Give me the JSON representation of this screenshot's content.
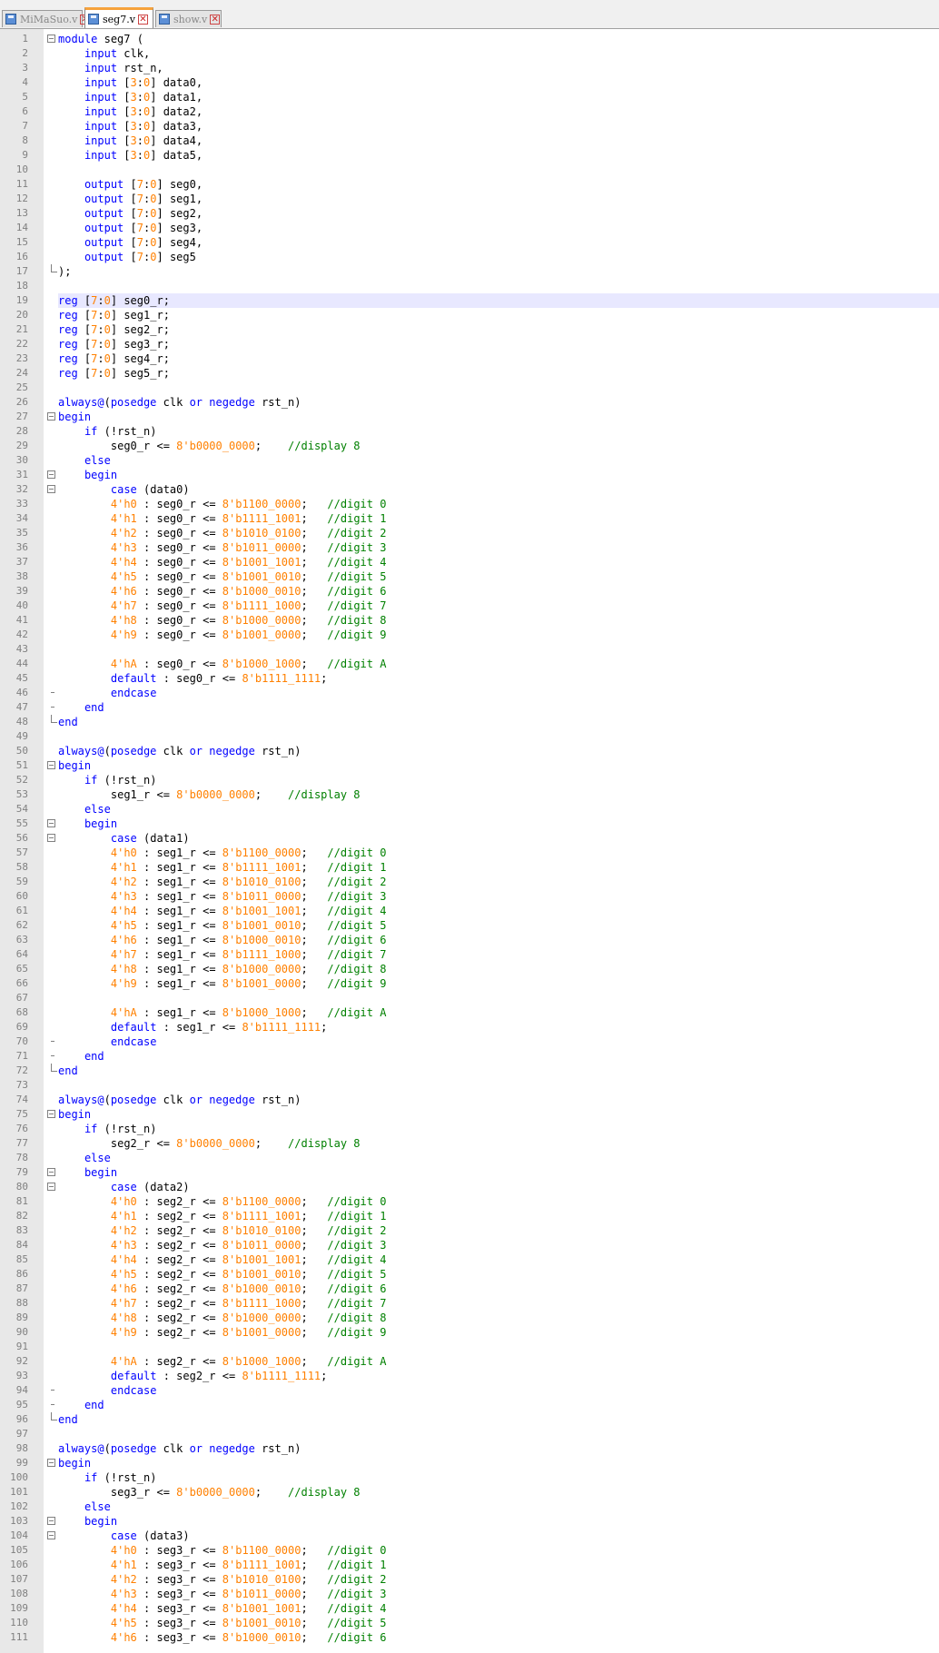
{
  "tabs": [
    {
      "label": "MiMaSuo.v",
      "active": false
    },
    {
      "label": "seg7.v",
      "active": true
    },
    {
      "label": "show.v",
      "active": false
    }
  ],
  "editor": {
    "highlight_line": 19,
    "lines": [
      "module seg7 (",
      "    input clk,",
      "    input rst_n,",
      "    input [3:0] data0,",
      "    input [3:0] data1,",
      "    input [3:0] data2,",
      "    input [3:0] data3,",
      "    input [3:0] data4,",
      "    input [3:0] data5,",
      "",
      "    output [7:0] seg0,",
      "    output [7:0] seg1,",
      "    output [7:0] seg2,",
      "    output [7:0] seg3,",
      "    output [7:0] seg4,",
      "    output [7:0] seg5",
      ");",
      "",
      "reg [7:0] seg0_r;",
      "reg [7:0] seg1_r;",
      "reg [7:0] seg2_r;",
      "reg [7:0] seg3_r;",
      "reg [7:0] seg4_r;",
      "reg [7:0] seg5_r;",
      "",
      "always@(posedge clk or negedge rst_n)",
      "begin",
      "    if (!rst_n)",
      "        seg0_r <= 8'b0000_0000;    //display 8",
      "    else",
      "    begin",
      "        case (data0)",
      "        4'h0 : seg0_r <= 8'b1100_0000;   //digit 0",
      "        4'h1 : seg0_r <= 8'b1111_1001;   //digit 1",
      "        4'h2 : seg0_r <= 8'b1010_0100;   //digit 2",
      "        4'h3 : seg0_r <= 8'b1011_0000;   //digit 3",
      "        4'h4 : seg0_r <= 8'b1001_1001;   //digit 4",
      "        4'h5 : seg0_r <= 8'b1001_0010;   //digit 5",
      "        4'h6 : seg0_r <= 8'b1000_0010;   //digit 6",
      "        4'h7 : seg0_r <= 8'b1111_1000;   //digit 7",
      "        4'h8 : seg0_r <= 8'b1000_0000;   //digit 8",
      "        4'h9 : seg0_r <= 8'b1001_0000;   //digit 9",
      "",
      "        4'hA : seg0_r <= 8'b1000_1000;   //digit A",
      "        default : seg0_r <= 8'b1111_1111;",
      "        endcase",
      "    end",
      "end",
      "",
      "always@(posedge clk or negedge rst_n)",
      "begin",
      "    if (!rst_n)",
      "        seg1_r <= 8'b0000_0000;    //display 8",
      "    else",
      "    begin",
      "        case (data1)",
      "        4'h0 : seg1_r <= 8'b1100_0000;   //digit 0",
      "        4'h1 : seg1_r <= 8'b1111_1001;   //digit 1",
      "        4'h2 : seg1_r <= 8'b1010_0100;   //digit 2",
      "        4'h3 : seg1_r <= 8'b1011_0000;   //digit 3",
      "        4'h4 : seg1_r <= 8'b1001_1001;   //digit 4",
      "        4'h5 : seg1_r <= 8'b1001_0010;   //digit 5",
      "        4'h6 : seg1_r <= 8'b1000_0010;   //digit 6",
      "        4'h7 : seg1_r <= 8'b1111_1000;   //digit 7",
      "        4'h8 : seg1_r <= 8'b1000_0000;   //digit 8",
      "        4'h9 : seg1_r <= 8'b1001_0000;   //digit 9",
      "",
      "        4'hA : seg1_r <= 8'b1000_1000;   //digit A",
      "        default : seg1_r <= 8'b1111_1111;",
      "        endcase",
      "    end",
      "end",
      "",
      "always@(posedge clk or negedge rst_n)",
      "begin",
      "    if (!rst_n)",
      "        seg2_r <= 8'b0000_0000;    //display 8",
      "    else",
      "    begin",
      "        case (data2)",
      "        4'h0 : seg2_r <= 8'b1100_0000;   //digit 0",
      "        4'h1 : seg2_r <= 8'b1111_1001;   //digit 1",
      "        4'h2 : seg2_r <= 8'b1010_0100;   //digit 2",
      "        4'h3 : seg2_r <= 8'b1011_0000;   //digit 3",
      "        4'h4 : seg2_r <= 8'b1001_1001;   //digit 4",
      "        4'h5 : seg2_r <= 8'b1001_0010;   //digit 5",
      "        4'h6 : seg2_r <= 8'b1000_0010;   //digit 6",
      "        4'h7 : seg2_r <= 8'b1111_1000;   //digit 7",
      "        4'h8 : seg2_r <= 8'b1000_0000;   //digit 8",
      "        4'h9 : seg2_r <= 8'b1001_0000;   //digit 9",
      "",
      "        4'hA : seg2_r <= 8'b1000_1000;   //digit A",
      "        default : seg2_r <= 8'b1111_1111;",
      "        endcase",
      "    end",
      "end",
      "",
      "always@(posedge clk or negedge rst_n)",
      "begin",
      "    if (!rst_n)",
      "        seg3_r <= 8'b0000_0000;    //display 8",
      "    else",
      "    begin",
      "        case (data3)",
      "        4'h0 : seg3_r <= 8'b1100_0000;   //digit 0",
      "        4'h1 : seg3_r <= 8'b1111_1001;   //digit 1",
      "        4'h2 : seg3_r <= 8'b1010_0100;   //digit 2",
      "        4'h3 : seg3_r <= 8'b1011_0000;   //digit 3",
      "        4'h4 : seg3_r <= 8'b1001_1001;   //digit 4",
      "        4'h5 : seg3_r <= 8'b1001_0010;   //digit 5",
      "        4'h6 : seg3_r <= 8'b1000_0010;   //digit 6"
    ]
  },
  "colors": {
    "keyword": "#0000ff",
    "number": "#ff8000",
    "comment": "#008000",
    "active_tab_accent": "#f6a23c",
    "current_line": "#e8e8ff"
  },
  "icons": {
    "tab_file": "save-icon",
    "tab_close": "close-icon",
    "fold": "fold-minus-icon"
  }
}
